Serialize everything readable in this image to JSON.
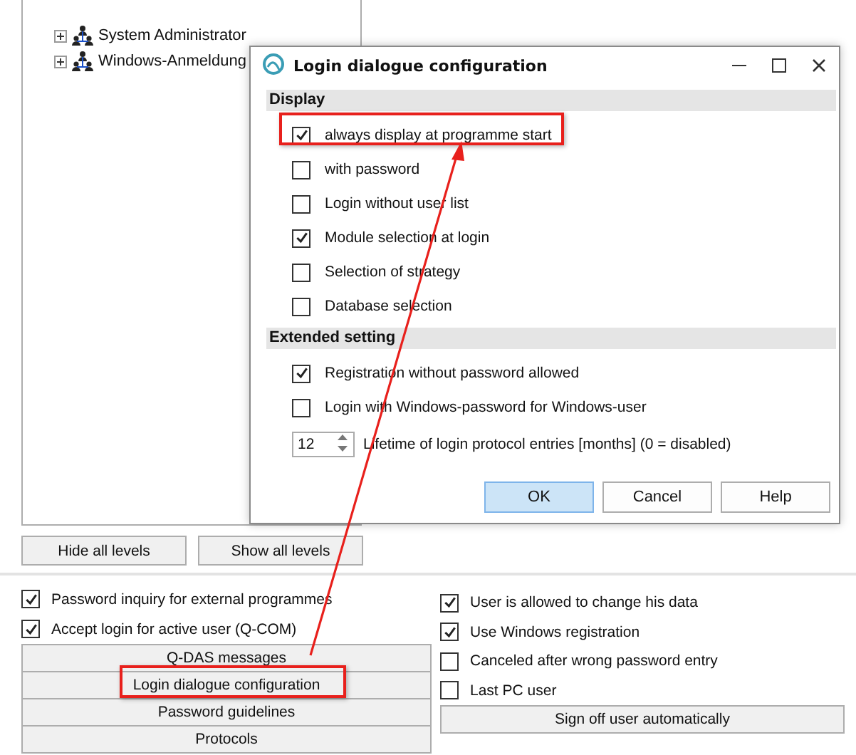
{
  "tree": {
    "items": [
      {
        "label": "System Administrator",
        "expanded": false
      },
      {
        "label": "Windows-Anmeldung",
        "expanded": false
      }
    ]
  },
  "dialog": {
    "title": "Login dialogue configuration",
    "sections": [
      {
        "heading": "Display",
        "options": [
          {
            "label": "always display at programme start",
            "checked": true
          },
          {
            "label": "with password",
            "checked": false
          },
          {
            "label": "Login without user list",
            "checked": false
          },
          {
            "label": "Module selection at login",
            "checked": true
          },
          {
            "label": "Selection of strategy",
            "checked": false
          },
          {
            "label": "Database selection",
            "checked": false
          }
        ]
      },
      {
        "heading": "Extended setting",
        "options": [
          {
            "label": "Registration without password allowed",
            "checked": true
          },
          {
            "label": "Login with Windows-password for Windows-user",
            "checked": false
          }
        ],
        "spinner": {
          "value": "12",
          "label": "Lifetime of login protocol entries [months] (0 = disabled)"
        }
      }
    ],
    "buttons": [
      {
        "label": "OK",
        "default": true
      },
      {
        "label": "Cancel",
        "default": false
      },
      {
        "label": "Help",
        "default": false
      }
    ]
  },
  "level_buttons": [
    "Hide all levels",
    "Show all levels"
  ],
  "left_options": [
    {
      "label": "Password inquiry for external programmes",
      "checked": true
    },
    {
      "label": "Accept login for active user (Q-COM)",
      "checked": true
    }
  ],
  "action_buttons": [
    "Q-DAS messages",
    "Login dialogue configuration",
    "Password guidelines",
    "Protocols"
  ],
  "right_options": [
    {
      "label": "User is allowed to change his data",
      "checked": true
    },
    {
      "label": "Use Windows registration",
      "checked": true
    },
    {
      "label": "Canceled after wrong password entry",
      "checked": false
    },
    {
      "label": "Last PC user",
      "checked": false
    }
  ],
  "sign_off_button": "Sign off user automatically"
}
